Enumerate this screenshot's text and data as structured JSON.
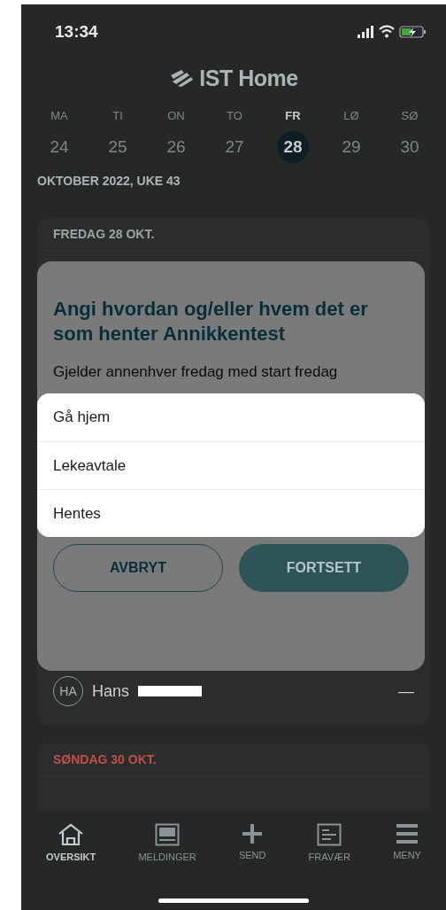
{
  "status_bar": {
    "time": "13:34"
  },
  "header": {
    "logo": "IST Home"
  },
  "week": {
    "days": [
      {
        "weekday": "MA",
        "date": "24",
        "selected": false
      },
      {
        "weekday": "TI",
        "date": "25",
        "selected": false
      },
      {
        "weekday": "ON",
        "date": "26",
        "selected": false
      },
      {
        "weekday": "TO",
        "date": "27",
        "selected": false
      },
      {
        "weekday": "FR",
        "date": "28",
        "selected": true
      },
      {
        "weekday": "LØ",
        "date": "29",
        "selected": false
      },
      {
        "weekday": "SØ",
        "date": "30",
        "selected": false
      }
    ],
    "month": "OKTOBER 2022, UKE 43"
  },
  "cards": [
    {
      "header": "FREDAG 28 OKT.",
      "color": "#9aa4a6",
      "rows": [
        {
          "initials": "HA",
          "name": "Hans",
          "redacted": true,
          "value": "—"
        }
      ]
    },
    {
      "header": "SØNDAG 30 OKT.",
      "color": "#c0504a"
    }
  ],
  "dialog": {
    "title": "Angi hvordan og/eller hvem det er som henter Annikkentest",
    "text": "Gjelder annenhver fredag med start fredag",
    "buttons": [
      {
        "label": "AVBRYT",
        "kind": "outline"
      },
      {
        "label": "FORTSETT",
        "kind": "filled"
      }
    ]
  },
  "picker": {
    "options": [
      "Gå hjem",
      "Lekeavtale",
      "Hentes"
    ]
  },
  "nav": [
    {
      "label": "OVERSIKT",
      "selected": true
    },
    {
      "label": "MELDINGER",
      "selected": false
    },
    {
      "label": "SEND",
      "selected": false
    },
    {
      "label": "FRAVÆR",
      "selected": false
    },
    {
      "label": "MENY",
      "selected": false
    }
  ]
}
